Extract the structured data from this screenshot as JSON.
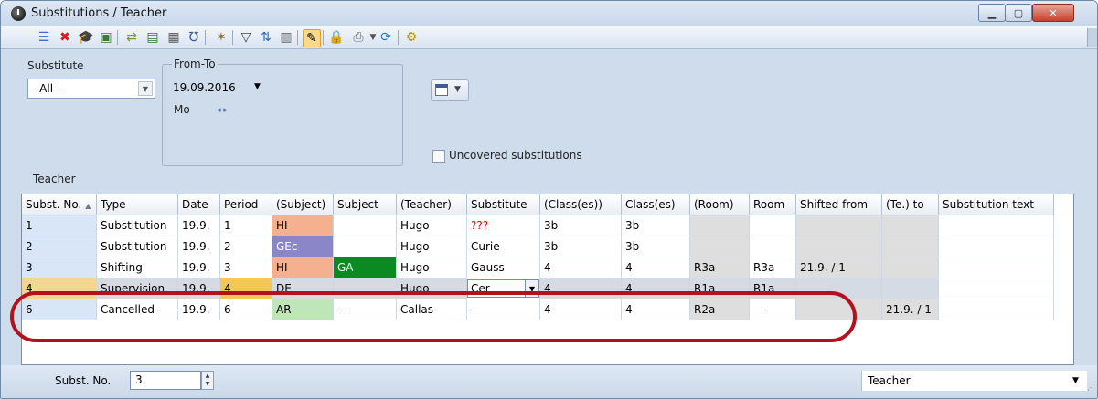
{
  "window": {
    "title": "Substitutions / Teacher"
  },
  "toolbar": {
    "icons": [
      "list-icon",
      "delete-icon",
      "graduate-cap-icon",
      "monitor-icon",
      "transfer-icon",
      "save-icon",
      "calculator-icon",
      "stethoscope-icon",
      "magic-wand-icon",
      "filter-icon",
      "sort-icon",
      "grid-icon",
      "edit-icon",
      "lock-icon",
      "print-icon",
      "refresh-icon",
      "settings-icon"
    ]
  },
  "filter": {
    "substitute_label": "Substitute",
    "substitute_value": "- All -",
    "fromto_label": "From-To",
    "date_value": "19.09.2016",
    "day_label": "Mo",
    "uncovered_label": "Uncovered substitutions",
    "view_label": "Teacher"
  },
  "grid": {
    "columns": [
      "Subst. No.",
      "Type",
      "Date",
      "Period",
      "(Subject)",
      "Subject",
      "(Teacher)",
      "Substitute",
      "(Class(es))",
      "Class(es)",
      "(Room)",
      "Room",
      "Shifted from",
      "(Te.) to",
      "Substitution text"
    ],
    "rows": [
      [
        "1",
        "Substitution",
        "19.9.",
        "1",
        "HI",
        "",
        "Hugo",
        "???",
        "3b",
        "3b",
        "",
        "",
        "",
        "",
        ""
      ],
      [
        "2",
        "Substitution",
        "19.9.",
        "2",
        "GEc",
        "",
        "Hugo",
        "Curie",
        "3b",
        "3b",
        "",
        "",
        "",
        "",
        ""
      ],
      [
        "3",
        "Shifting",
        "19.9.",
        "3",
        "HI",
        "GA",
        "Hugo",
        "Gauss",
        "4",
        "4",
        "R3a",
        "R3a",
        "21.9. / 1",
        "",
        ""
      ],
      [
        "4",
        "Supervision",
        "19.9.",
        "4",
        "DE",
        "",
        "Hugo",
        "Cer",
        "4",
        "4",
        "R1a",
        "R1a",
        "",
        "",
        ""
      ],
      [
        "6",
        "Cancelled",
        "19.9.",
        "6",
        "AR",
        "---",
        "Callas",
        "---",
        "4",
        "4",
        "R2a",
        "---",
        "",
        "21.9. / 1",
        ""
      ]
    ]
  },
  "status": {
    "subst_no_label": "Subst. No.",
    "subst_no_value": "3",
    "view_select": "Teacher"
  },
  "colors": {
    "hi": "#f5b18f",
    "gec": "#8a86c8",
    "ga": "#0a8a20",
    "de": "#f8c2a8",
    "ar": "#bfe6b8",
    "red_text": "#e00000",
    "highlight_ring": "#b3111c"
  }
}
